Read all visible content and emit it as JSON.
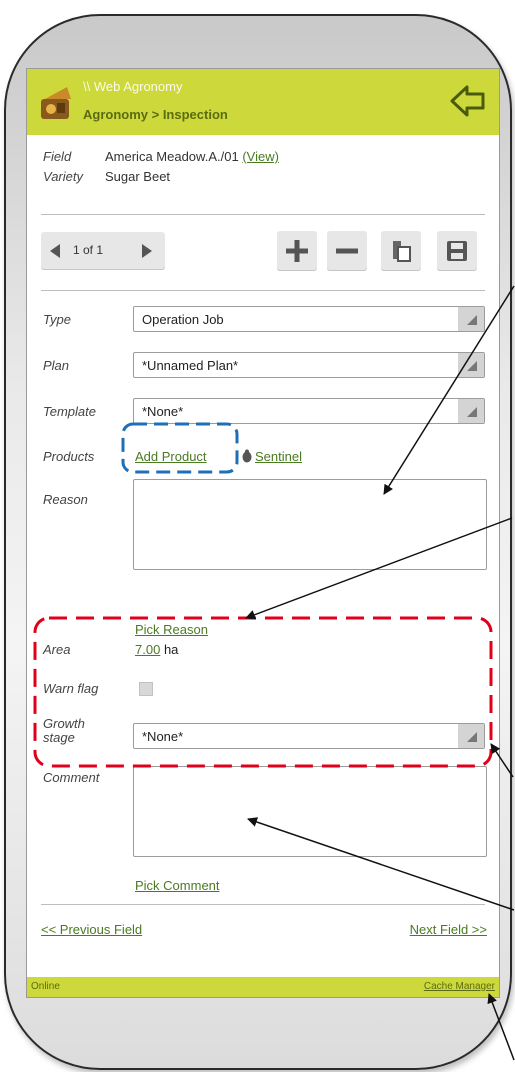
{
  "header": {
    "app_title": "\\\\ Web Agronomy",
    "breadcrumb": "Agronomy > Inspection"
  },
  "info": {
    "field_label": "Field",
    "field_value": "America Meadow.A./01",
    "view_link": "(View)",
    "variety_label": "Variety",
    "variety_value": "Sugar Beet"
  },
  "pager": {
    "text": "1 of 1"
  },
  "icons": {
    "prev": "arrow-left-icon",
    "next": "arrow-right-icon",
    "add": "plus-icon",
    "remove": "minus-icon",
    "copy": "copy-icon",
    "save": "save-icon",
    "back": "back-arrow-icon",
    "sentinel": "bug-icon"
  },
  "form": {
    "type_label": "Type",
    "type_value": "Operation Job",
    "plan_label": "Plan",
    "plan_value": "*Unnamed Plan*",
    "template_label": "Template",
    "template_value": "*None*",
    "products_label": "Products",
    "add_product": "Add Product",
    "sentinel": "Sentinel",
    "reason_label": "Reason",
    "pick_reason": "Pick Reason",
    "area_label": "Area",
    "area_value": "7.00",
    "area_unit": "ha",
    "warn_label": "Warn flag",
    "growth_label_1": "Growth",
    "growth_label_2": "stage",
    "growth_value": "*None*",
    "comment_label": "Comment",
    "pick_comment": "Pick Comment"
  },
  "footer": {
    "prev_field": "<< Previous Field",
    "next_field": "Next Field >>"
  },
  "status": {
    "left": "Online",
    "right": "Cache Manager"
  },
  "colors": {
    "header_bg": "#cdd93a",
    "link": "#4a7a22",
    "highlight_red": "#e0001b",
    "highlight_blue": "#1f6fb8"
  }
}
